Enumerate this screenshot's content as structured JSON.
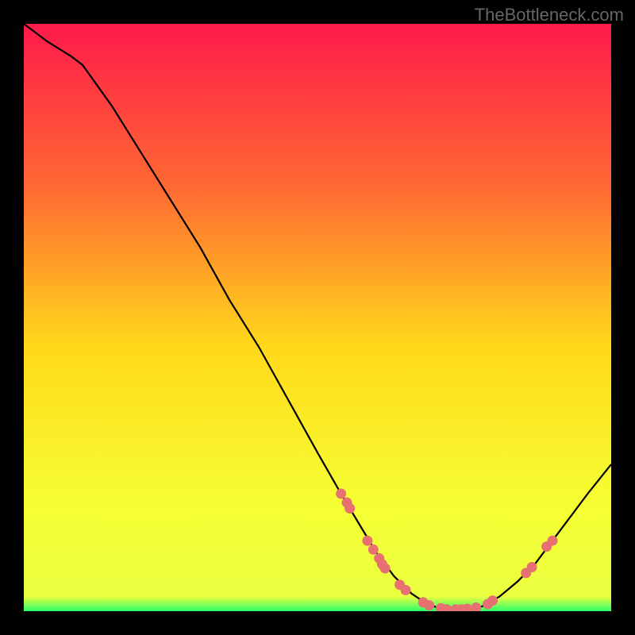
{
  "watermark": "TheBottleneck.com",
  "chart_data": {
    "type": "line",
    "title": "",
    "xlabel": "",
    "ylabel": "",
    "xlim": [
      0,
      100
    ],
    "ylim": [
      0,
      100
    ],
    "background_gradient": {
      "top": "#ff1a4a",
      "upper_mid": "#ff7a33",
      "mid": "#ffd91a",
      "lower_mid": "#f8ff33",
      "bottom": "#2aff6a"
    },
    "curve": [
      {
        "x": 0,
        "y": 100
      },
      {
        "x": 4,
        "y": 97
      },
      {
        "x": 8,
        "y": 94.5
      },
      {
        "x": 10,
        "y": 93
      },
      {
        "x": 15,
        "y": 86
      },
      {
        "x": 20,
        "y": 78
      },
      {
        "x": 25,
        "y": 70
      },
      {
        "x": 30,
        "y": 62
      },
      {
        "x": 35,
        "y": 53
      },
      {
        "x": 40,
        "y": 45
      },
      {
        "x": 45,
        "y": 36
      },
      {
        "x": 50,
        "y": 27
      },
      {
        "x": 54,
        "y": 20
      },
      {
        "x": 57,
        "y": 15
      },
      {
        "x": 60,
        "y": 10
      },
      {
        "x": 63,
        "y": 6
      },
      {
        "x": 66,
        "y": 3
      },
      {
        "x": 69,
        "y": 1
      },
      {
        "x": 72,
        "y": 0.3
      },
      {
        "x": 75,
        "y": 0.3
      },
      {
        "x": 78,
        "y": 0.8
      },
      {
        "x": 81,
        "y": 2.5
      },
      {
        "x": 84,
        "y": 5
      },
      {
        "x": 87,
        "y": 8
      },
      {
        "x": 90,
        "y": 12
      },
      {
        "x": 93,
        "y": 16
      },
      {
        "x": 96,
        "y": 20
      },
      {
        "x": 100,
        "y": 25
      }
    ],
    "dots": [
      {
        "x": 54,
        "y": 20
      },
      {
        "x": 55,
        "y": 18.5
      },
      {
        "x": 55.5,
        "y": 17.5
      },
      {
        "x": 58.5,
        "y": 12
      },
      {
        "x": 59.5,
        "y": 10.5
      },
      {
        "x": 60.5,
        "y": 9
      },
      {
        "x": 61,
        "y": 8
      },
      {
        "x": 61.5,
        "y": 7.3
      },
      {
        "x": 64,
        "y": 4.5
      },
      {
        "x": 65,
        "y": 3.6
      },
      {
        "x": 68,
        "y": 1.5
      },
      {
        "x": 69,
        "y": 1
      },
      {
        "x": 71,
        "y": 0.5
      },
      {
        "x": 72,
        "y": 0.3
      },
      {
        "x": 73.5,
        "y": 0.3
      },
      {
        "x": 74.5,
        "y": 0.3
      },
      {
        "x": 75.5,
        "y": 0.4
      },
      {
        "x": 77,
        "y": 0.6
      },
      {
        "x": 79,
        "y": 1.2
      },
      {
        "x": 79.8,
        "y": 1.8
      },
      {
        "x": 85.5,
        "y": 6.5
      },
      {
        "x": 86.5,
        "y": 7.5
      },
      {
        "x": 89,
        "y": 11
      },
      {
        "x": 90,
        "y": 12
      }
    ],
    "dot_color": "#e77070",
    "curve_color": "#000000"
  }
}
